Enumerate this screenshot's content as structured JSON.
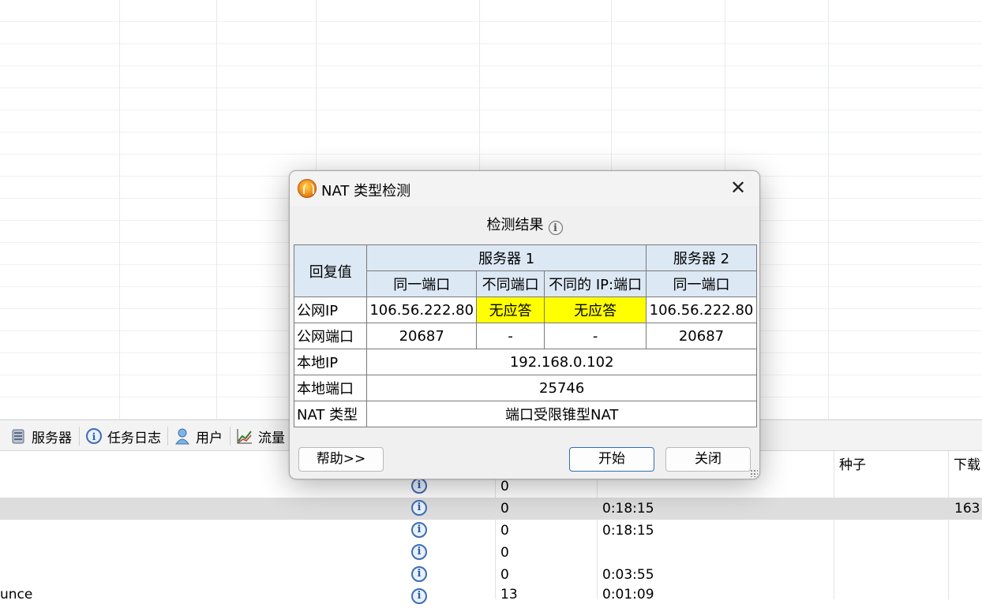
{
  "tabs": [
    {
      "label": "服务器",
      "icon": "server-icon"
    },
    {
      "label": "任务日志",
      "icon": "info-icon"
    },
    {
      "label": "用户",
      "icon": "user-icon"
    },
    {
      "label": "流量",
      "icon": "chart-icon"
    }
  ],
  "list": {
    "headers": {
      "seed": "种子",
      "download": "下载"
    },
    "rows": [
      {
        "name": "",
        "count": "0",
        "time": "",
        "download": ""
      },
      {
        "name": "",
        "count": "0",
        "time": "0:18:15",
        "download": "163"
      },
      {
        "name": "",
        "count": "0",
        "time": "0:18:15",
        "download": ""
      },
      {
        "name": "",
        "count": "0",
        "time": "",
        "download": ""
      },
      {
        "name": "",
        "count": "0",
        "time": "0:03:55",
        "download": ""
      },
      {
        "name": "unce",
        "count": "13",
        "time": "0:01:09",
        "download": ""
      }
    ]
  },
  "dialog": {
    "title": "NAT 类型检测",
    "section_title": "检测结果",
    "table": {
      "reply_label": "回复值",
      "server1": "服务器 1",
      "server2": "服务器 2",
      "sub_same_port": "同一端口",
      "sub_diff_port": "不同端口",
      "sub_diff_ip_port": "不同的 IP:端口",
      "sub_same_port2": "同一端口",
      "public_ip_label": "公网IP",
      "public_ip": [
        "106.56.222.80",
        "无应答",
        "无应答",
        "106.56.222.80"
      ],
      "public_port_label": "公网端口",
      "public_port": [
        "20687",
        "-",
        "-",
        "20687"
      ],
      "local_ip_label": "本地IP",
      "local_ip": "192.168.0.102",
      "local_port_label": "本地端口",
      "local_port": "25746",
      "nat_type_label": "NAT 类型",
      "nat_type": "端口受限锥型NAT"
    },
    "buttons": {
      "help": "帮助>>",
      "start": "开始",
      "close": "关闭"
    }
  },
  "colors": {
    "no_response_bg": "#ffff00",
    "header_bg": "#dce8f4",
    "primary_border": "#2f6fba"
  }
}
